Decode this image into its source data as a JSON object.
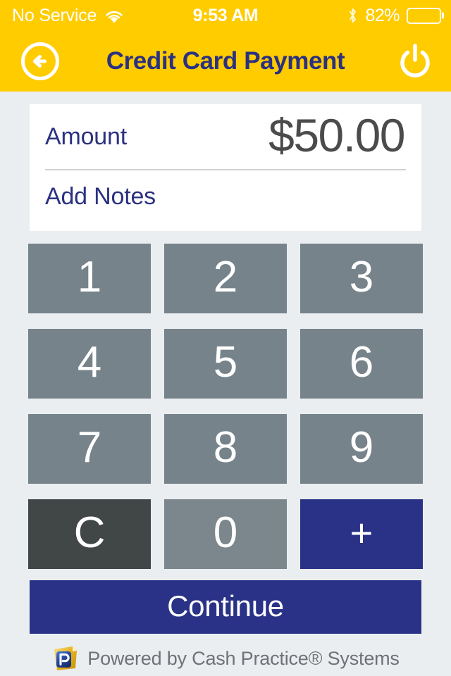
{
  "status_bar": {
    "carrier": "No Service",
    "wifi_icon": "wifi-icon",
    "time": "9:53 AM",
    "bluetooth_icon": "bluetooth-icon",
    "battery_percent": "82%",
    "battery_level": 82,
    "battery_icon": "battery-icon"
  },
  "nav": {
    "back_icon": "back-arrow-circle-icon",
    "title": "Credit Card Payment",
    "power_icon": "power-icon"
  },
  "card": {
    "amount_label": "Amount",
    "amount_value": "$50.00",
    "notes_label": "Add Notes"
  },
  "keypad": {
    "keys": [
      {
        "label": "1",
        "name": "key-1",
        "variant": "digit"
      },
      {
        "label": "2",
        "name": "key-2",
        "variant": "digit"
      },
      {
        "label": "3",
        "name": "key-3",
        "variant": "digit"
      },
      {
        "label": "4",
        "name": "key-4",
        "variant": "digit"
      },
      {
        "label": "5",
        "name": "key-5",
        "variant": "digit"
      },
      {
        "label": "6",
        "name": "key-6",
        "variant": "digit"
      },
      {
        "label": "7",
        "name": "key-7",
        "variant": "digit"
      },
      {
        "label": "8",
        "name": "key-8",
        "variant": "digit"
      },
      {
        "label": "9",
        "name": "key-9",
        "variant": "digit"
      },
      {
        "label": "C",
        "name": "key-clear",
        "variant": "clear"
      },
      {
        "label": "0",
        "name": "key-0",
        "variant": "zero"
      },
      {
        "label": "+",
        "name": "key-plus",
        "variant": "plus"
      }
    ]
  },
  "actions": {
    "continue_label": "Continue"
  },
  "footer": {
    "logo_icon": "cash-practice-logo-icon",
    "text": "Powered by Cash Practice® Systems"
  },
  "colors": {
    "header_yellow": "#FFCC00",
    "navy": "#2A3287",
    "key_gray": "#77838A",
    "key_clear_dark": "#414647",
    "background": "#EAEEF0",
    "amount_text": "#4B4B4B"
  }
}
